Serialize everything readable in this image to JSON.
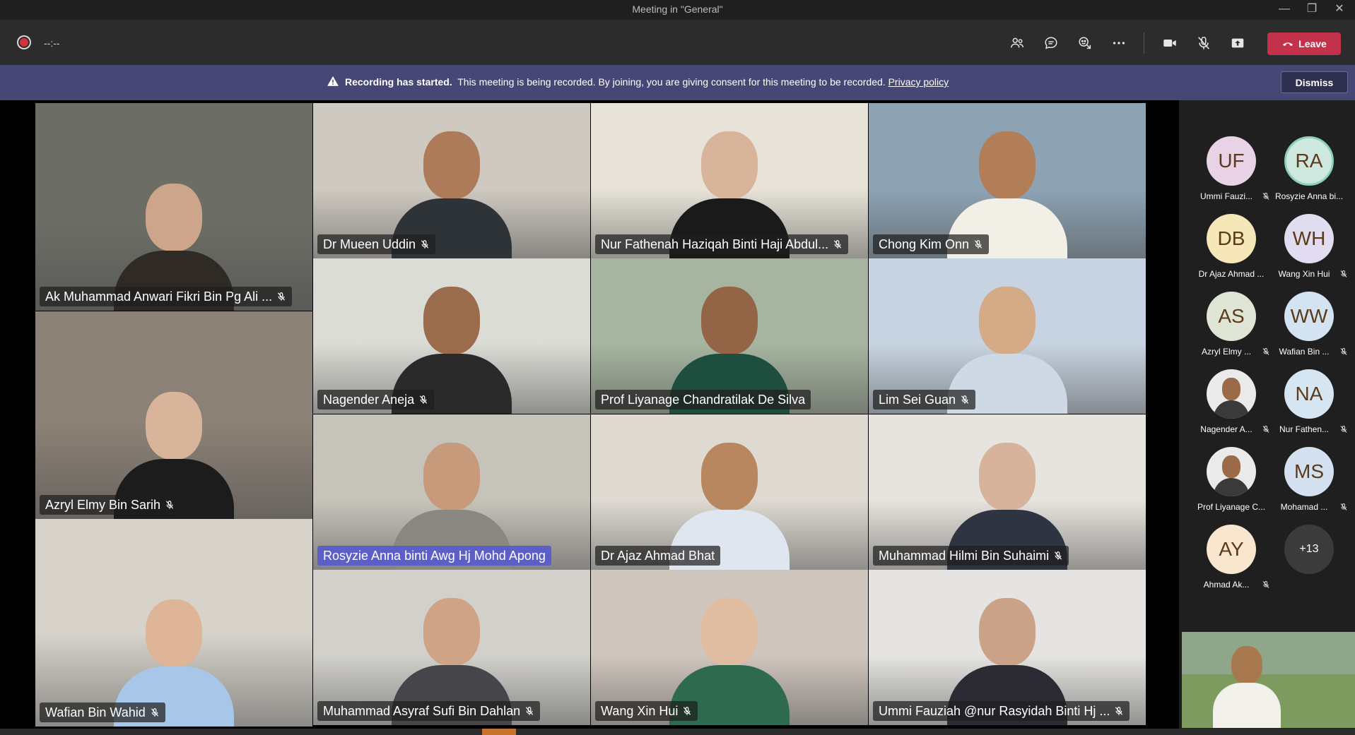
{
  "window": {
    "title": "Meeting in \"General\""
  },
  "toolbar": {
    "timer": "--:--",
    "leave_label": "Leave",
    "icons": [
      "people-icon",
      "chat-icon",
      "reactions-icon",
      "more-icon",
      "camera-icon",
      "mic-off-icon",
      "share-tray-icon",
      "phone-icon"
    ]
  },
  "banner": {
    "bold": "Recording has started.",
    "text": "This meeting is being recorded. By joining, you are giving consent for this meeting to be recorded.",
    "link": "Privacy policy",
    "dismiss_label": "Dismiss"
  },
  "tiles": [
    {
      "name": "Ak Muhammad Anwari Fikri Bin Pg Ali ...",
      "muted": true
    },
    {
      "name": "Dr Mueen Uddin",
      "muted": true
    },
    {
      "name": "Nur Fathenah Haziqah Binti Haji Abdul...",
      "muted": true
    },
    {
      "name": "Chong Kim Onn",
      "muted": true
    },
    {
      "name": "Nagender Aneja",
      "muted": true
    },
    {
      "name": "Prof Liyanage Chandratilak De Silva",
      "muted": false
    },
    {
      "name": "Lim Sei Guan",
      "muted": true
    },
    {
      "name": "Azryl Elmy Bin Sarih",
      "muted": true
    },
    {
      "name": "Rosyzie Anna binti Awg Hj Mohd Apong",
      "muted": false,
      "speaking": true
    },
    {
      "name": "Dr Ajaz Ahmad Bhat",
      "muted": false
    },
    {
      "name": "Muhammad Hilmi Bin Suhaimi",
      "muted": true
    },
    {
      "name": "Wafian Bin Wahid",
      "muted": true
    },
    {
      "name": "Muhammad Asyraf Sufi Bin Dahlan",
      "muted": true
    },
    {
      "name": "Wang Xin Hui",
      "muted": true
    },
    {
      "name": "Ummi Fauziah @nur Rasyidah Binti Hj ...",
      "muted": true
    }
  ],
  "roster": [
    {
      "initials": "UF",
      "name": "Ummi Fauzi...",
      "muted": true,
      "color": "#e8d3e6"
    },
    {
      "initials": "RA",
      "name": "Rosyzie Anna bi...",
      "muted": false,
      "color": "#cfe8df"
    },
    {
      "initials": "DB",
      "name": "Dr Ajaz Ahmad ...",
      "muted": false,
      "color": "#f6e7b8"
    },
    {
      "initials": "WH",
      "name": "Wang Xin Hui",
      "muted": true,
      "color": "#e2dcf0"
    },
    {
      "initials": "AS",
      "name": "Azryl Elmy ...",
      "muted": true,
      "color": "#dfe5d5"
    },
    {
      "initials": "WW",
      "name": "Wafian Bin ...",
      "muted": true,
      "color": "#d3e3f2"
    },
    {
      "initials": "",
      "name": "Nagender A...",
      "muted": true,
      "color": "#e9e9e9"
    },
    {
      "initials": "NA",
      "name": "Nur Fathen...",
      "muted": true,
      "color": "#d5e5f2"
    },
    {
      "initials": "",
      "name": "Prof Liyanage C...",
      "muted": false,
      "color": "#e9e9e9"
    },
    {
      "initials": "MS",
      "name": "Mohamad ...",
      "muted": true,
      "color": "#d3e0f0"
    },
    {
      "initials": "AY",
      "name": "Ahmad Ak...",
      "muted": true,
      "color": "#f9e6cf"
    },
    {
      "initials": "+13",
      "name": "",
      "muted": false,
      "color": "#3b3b3b"
    }
  ]
}
